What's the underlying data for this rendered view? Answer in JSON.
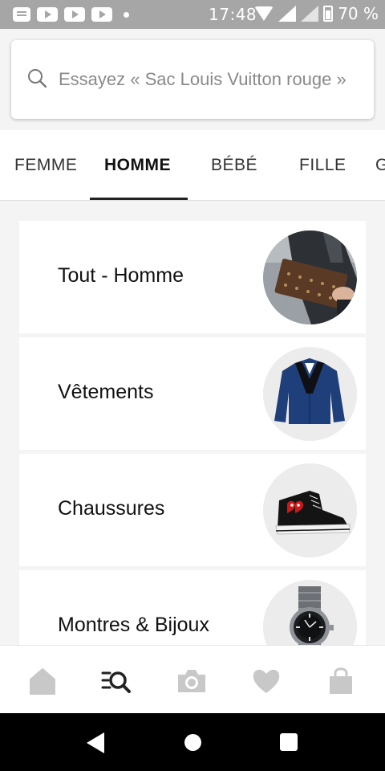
{
  "status_bar": {
    "time": "17:48",
    "battery": "70 %",
    "icons": [
      "notes-icon",
      "youtube-icon",
      "youtube-icon",
      "youtube-icon",
      "dot-icon",
      "wifi-icon",
      "signal-icon",
      "signal-icon",
      "battery-icon"
    ]
  },
  "search": {
    "placeholder": "Essayez « Sac Louis Vuitton rouge »",
    "icon": "search-icon"
  },
  "tabs": [
    {
      "label": "FEMME",
      "active": false
    },
    {
      "label": "HOMME",
      "active": true
    },
    {
      "label": "BÉBÉ",
      "active": false
    },
    {
      "label": "FILLE",
      "active": false
    },
    {
      "label": "G",
      "active": false
    }
  ],
  "categories": [
    {
      "label": "Tout - Homme",
      "image": "man-with-monogram-clutch"
    },
    {
      "label": "Vêtements",
      "image": "navy-blazer"
    },
    {
      "label": "Chaussures",
      "image": "black-high-top-sneaker"
    },
    {
      "label": "Montres & Bijoux",
      "image": "steel-wristwatch"
    }
  ],
  "bottom_nav": [
    {
      "name": "home-icon",
      "active": false
    },
    {
      "name": "search-list-icon",
      "active": true
    },
    {
      "name": "camera-icon",
      "active": false
    },
    {
      "name": "heart-icon",
      "active": false
    },
    {
      "name": "bag-icon",
      "active": false
    }
  ],
  "colors": {
    "accent": "#222222",
    "inactive_icon": "#c8c8c8",
    "status_bar": "#a6a6a6"
  }
}
